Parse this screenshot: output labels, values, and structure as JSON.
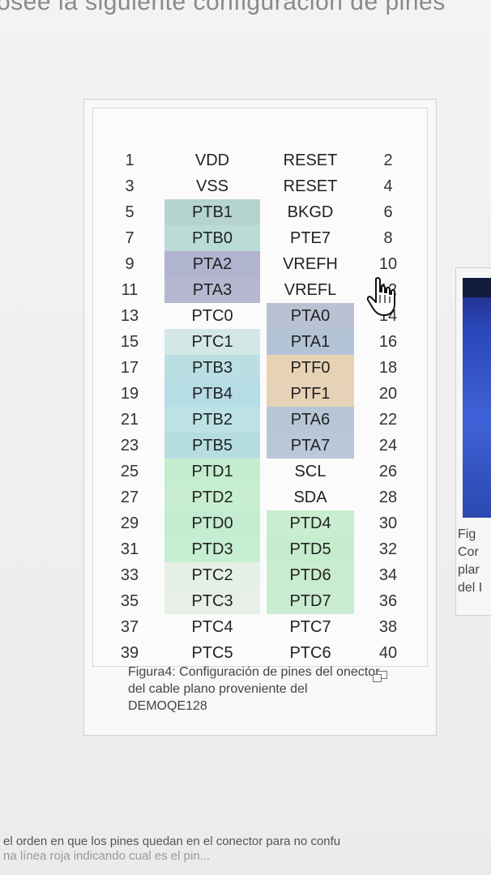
{
  "top_text": "osee la siguiente configuración de pines",
  "figure": {
    "rows": [
      {
        "pin_left": "1",
        "signal_left": "VDD",
        "signal_right": "RESET",
        "pin_right": "2"
      },
      {
        "pin_left": "3",
        "signal_left": "VSS",
        "signal_right": "RESET",
        "pin_right": "4"
      },
      {
        "pin_left": "5",
        "signal_left": "PTB1",
        "signal_right": "BKGD",
        "pin_right": "6"
      },
      {
        "pin_left": "7",
        "signal_left": "PTB0",
        "signal_right": "PTE7",
        "pin_right": "8"
      },
      {
        "pin_left": "9",
        "signal_left": "PTA2",
        "signal_right": "VREFH",
        "pin_right": "10"
      },
      {
        "pin_left": "11",
        "signal_left": "PTA3",
        "signal_right": "VREFL",
        "pin_right": "12"
      },
      {
        "pin_left": "13",
        "signal_left": "PTC0",
        "signal_right": "PTA0",
        "pin_right": "14"
      },
      {
        "pin_left": "15",
        "signal_left": "PTC1",
        "signal_right": "PTA1",
        "pin_right": "16"
      },
      {
        "pin_left": "17",
        "signal_left": "PTB3",
        "signal_right": "PTF0",
        "pin_right": "18"
      },
      {
        "pin_left": "19",
        "signal_left": "PTB4",
        "signal_right": "PTF1",
        "pin_right": "20"
      },
      {
        "pin_left": "21",
        "signal_left": "PTB2",
        "signal_right": "PTA6",
        "pin_right": "22"
      },
      {
        "pin_left": "23",
        "signal_left": "PTB5",
        "signal_right": "PTA7",
        "pin_right": "24"
      },
      {
        "pin_left": "25",
        "signal_left": "PTD1",
        "signal_right": "SCL",
        "pin_right": "26"
      },
      {
        "pin_left": "27",
        "signal_left": "PTD2",
        "signal_right": "SDA",
        "pin_right": "28"
      },
      {
        "pin_left": "29",
        "signal_left": "PTD0",
        "signal_right": "PTD4",
        "pin_right": "30"
      },
      {
        "pin_left": "31",
        "signal_left": "PTD3",
        "signal_right": "PTD5",
        "pin_right": "32"
      },
      {
        "pin_left": "33",
        "signal_left": "PTC2",
        "signal_right": "PTD6",
        "pin_right": "34"
      },
      {
        "pin_left": "35",
        "signal_left": "PTC3",
        "signal_right": "PTD7",
        "pin_right": "36"
      },
      {
        "pin_left": "37",
        "signal_left": "PTC4",
        "signal_right": "PTC7",
        "pin_right": "38"
      },
      {
        "pin_left": "39",
        "signal_left": "PTC5",
        "signal_right": "PTC6",
        "pin_right": "40"
      }
    ],
    "cell_colors_left": [
      "",
      "",
      "#b5d4cf",
      "#b9dcd6",
      "#b1b4cf",
      "#b6b8d2",
      "",
      "#d3e8e6",
      "#b9dfe3",
      "#b6dce6",
      "#bde2e6",
      "#b5dde0",
      "#c4edcd",
      "#c6eecf",
      "#c3ecd0",
      "#c6eed2",
      "#e4efe6",
      "#e7efe7",
      "",
      ""
    ],
    "cell_colors_right": [
      "",
      "",
      "",
      "",
      "",
      "",
      "#b9c2d3",
      "#b2c4d5",
      "#e7d3b3",
      "#e6d2b6",
      "#b7c6d6",
      "#b9c7d8",
      "",
      "",
      "#c8eecf",
      "#c6ecce",
      "#c8eccd",
      "#c9ecd0",
      "",
      ""
    ],
    "caption": "Figura4: Configuración de pines del onector del cable plano proveniente del DEMOQE128",
    "expand_icon": "enlarge-icon"
  },
  "side_figure": {
    "caption_lines": [
      "Fig",
      "Cor",
      "plar",
      "del I"
    ]
  },
  "cursor": "hand-pointer-icon",
  "bottom_text": {
    "line1": "el orden en que los pines quedan en el conector para no confu",
    "line2": "na línea roja indicando cual es el pin..."
  }
}
